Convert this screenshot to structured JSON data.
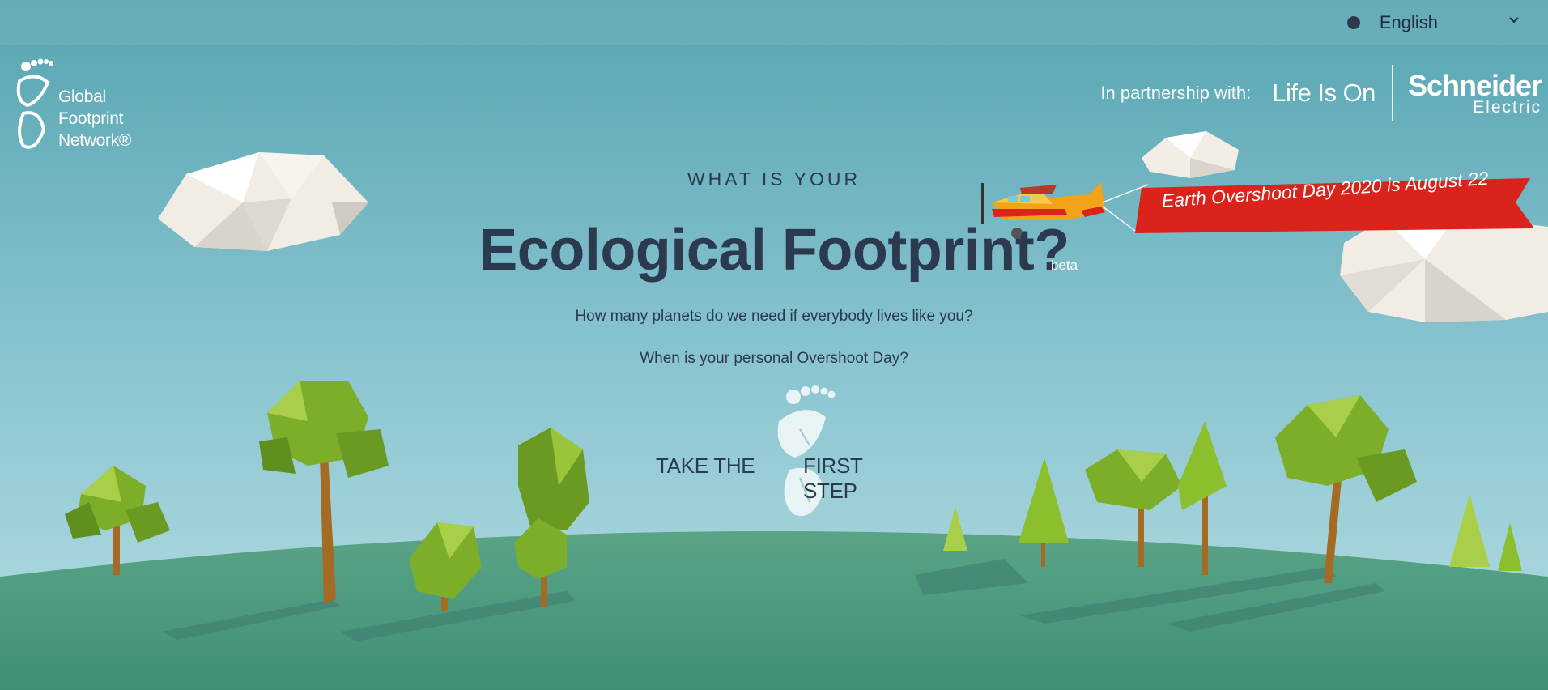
{
  "language": {
    "selected": "English"
  },
  "logo": {
    "line1": "Global",
    "line2": "Footprint",
    "line3": "Network®"
  },
  "partner": {
    "label": "In partnership with:",
    "slogan": "Life Is On",
    "brand_top": "Schneider",
    "brand_bottom": "Electric"
  },
  "hero": {
    "eyebrow": "WHAT IS YOUR",
    "title": "Ecological Footprint?",
    "beta": "beta",
    "question1": "How many planets do we need if everybody lives like you?",
    "question2": "When is your personal Overshoot Day?"
  },
  "cta": {
    "left": "TAKE THE",
    "right": "FIRST STEP"
  },
  "banner": {
    "text": "Earth Overshoot Day 2020 is August 22"
  },
  "colors": {
    "sky_top": "#59a7b4",
    "sky_bottom": "#a7d3dc",
    "ground": "#4b9a82",
    "banner": "#d9231b",
    "title": "#2b3a4e"
  }
}
